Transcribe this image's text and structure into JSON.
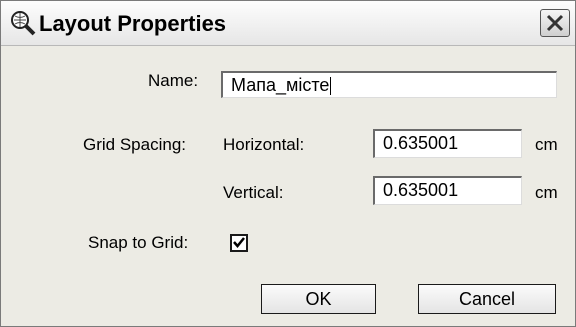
{
  "window": {
    "title": "Layout Properties",
    "title_icon": "magnifier-globe-icon",
    "close_icon": "close-icon"
  },
  "form": {
    "name_label": "Name:",
    "name_value": "Мапа_місте",
    "grid_spacing_label": "Grid Spacing:",
    "horizontal_label": "Horizontal:",
    "horizontal_value": "0.635001",
    "horizontal_unit": "cm",
    "vertical_label": "Vertical:",
    "vertical_value": "0.635001",
    "vertical_unit": "cm",
    "snap_label": "Snap to Grid:",
    "snap_checked": true
  },
  "buttons": {
    "ok_label": "OK",
    "cancel_label": "Cancel"
  }
}
